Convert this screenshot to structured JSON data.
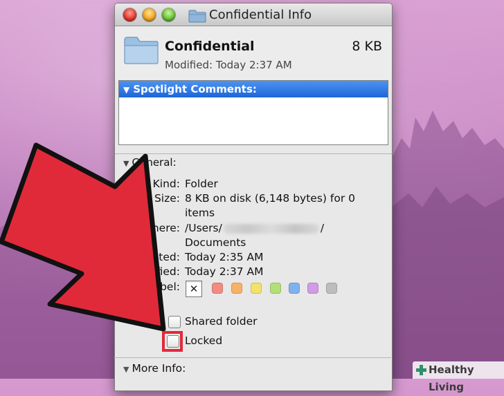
{
  "window": {
    "title": "Confidential Info"
  },
  "header": {
    "name": "Confidential",
    "size": "8 KB",
    "modified": "Modified: Today 2:37 AM"
  },
  "spotlight": {
    "label": "Spotlight Comments:",
    "value": ""
  },
  "general": {
    "label": "General:",
    "kind_label": "Kind:",
    "kind_value": "Folder",
    "size_label": "Size:",
    "size_value_1": "8 KB on disk (6,148 bytes) for 0",
    "size_value_2": "items",
    "where_label": "Where:",
    "where_value_prefix": "/Users/",
    "where_value_suffix": "/",
    "where_value_2": "Documents",
    "created_label": "Created:",
    "created_value": "Today 2:35 AM",
    "modified_label": "Modified:",
    "modified_value": "Today 2:37 AM",
    "label_label": "Label:",
    "label_none": "✕",
    "label_colors": [
      "#f28b82",
      "#f6b266",
      "#f2e26a",
      "#b3df78",
      "#7fb2ec",
      "#d29be5",
      "#bdbdbd"
    ]
  },
  "options": {
    "shared_folder": "Shared folder",
    "locked": "Locked"
  },
  "more_info": {
    "label": "More Info:"
  },
  "watermark": {
    "text": "Healthy Living"
  },
  "colors": {
    "arrow": "#e02a3a",
    "accent": "#1d66d8"
  }
}
